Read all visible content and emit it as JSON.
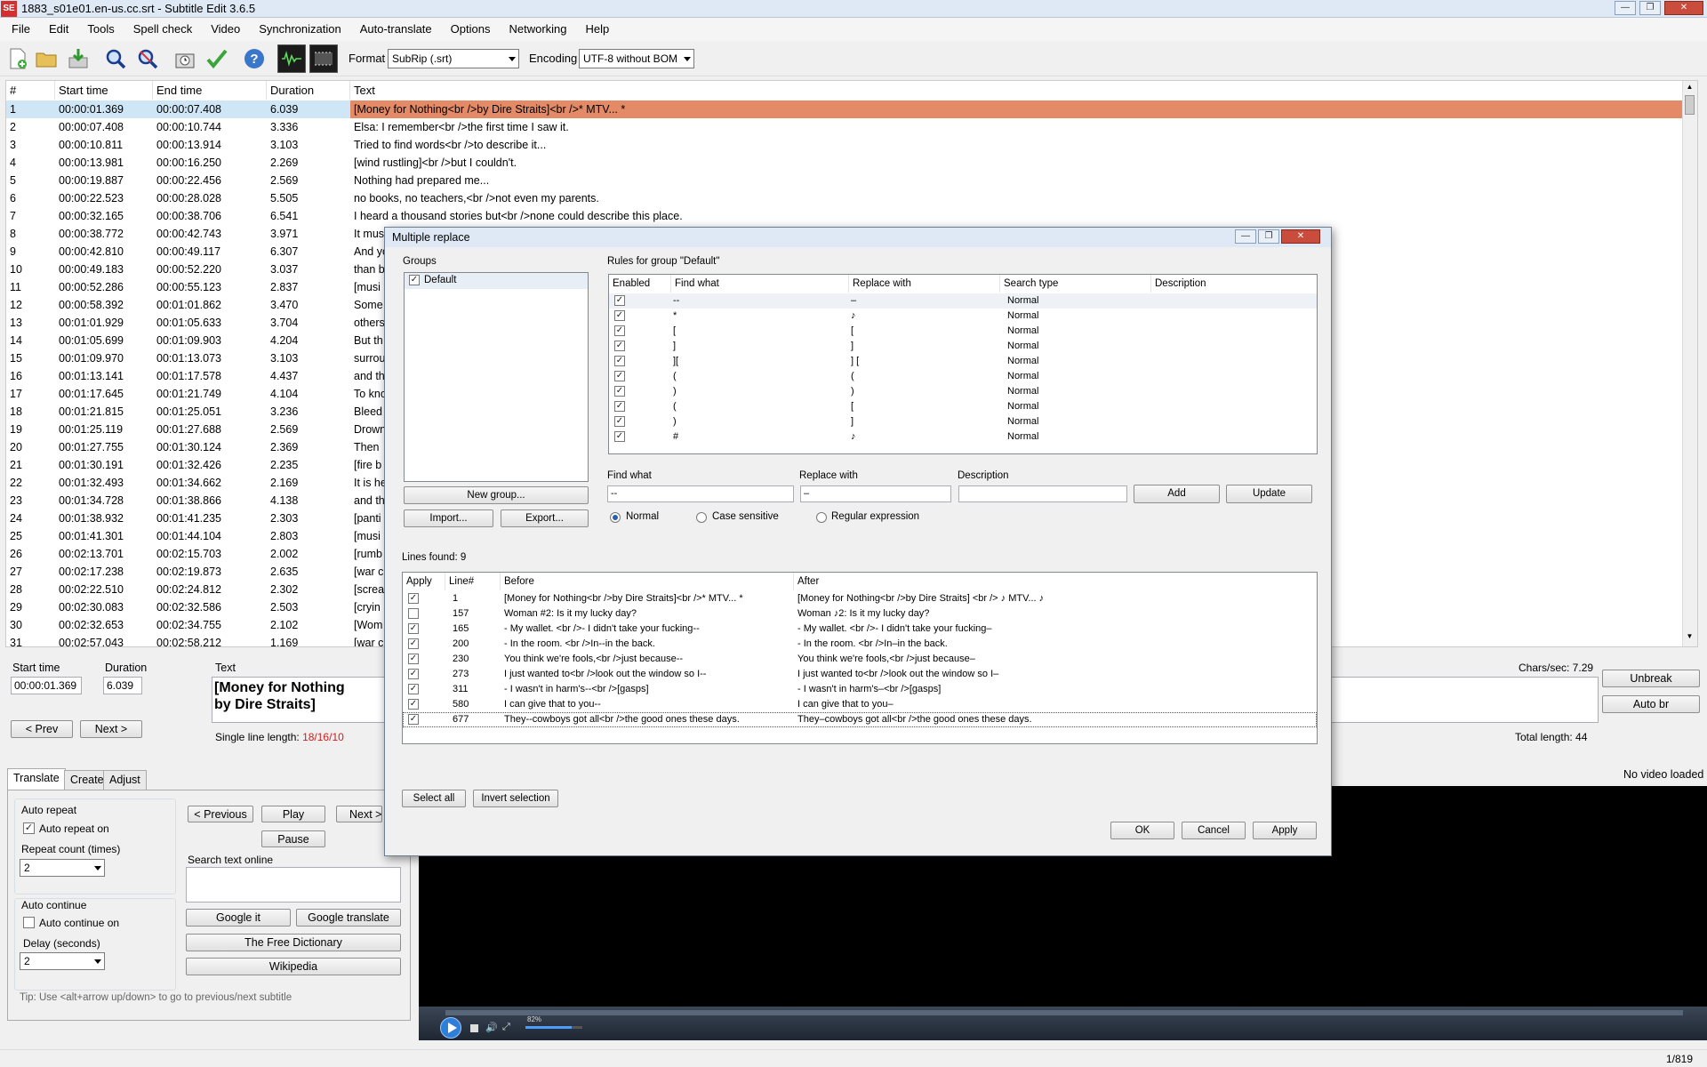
{
  "window": {
    "title": "1883_s01e01.en-us.cc.srt - Subtitle Edit 3.6.5",
    "icon_text": "SE"
  },
  "menu": [
    "File",
    "Edit",
    "Tools",
    "Spell check",
    "Video",
    "Synchronization",
    "Auto-translate",
    "Options",
    "Networking",
    "Help"
  ],
  "toolbar": {
    "icons": [
      "new-file-icon",
      "open-folder-icon",
      "save-icon",
      "find-icon",
      "replace-icon",
      "visual-sync-icon",
      "spell-check-icon",
      "help-icon",
      "waveform-icon",
      "video-icon"
    ],
    "format_label": "Format",
    "format_value": "SubRip (.srt)",
    "encoding_label": "Encoding",
    "encoding_value": "UTF-8 without BOM"
  },
  "grid": {
    "headers": [
      "#",
      "Start time",
      "End time",
      "Duration",
      "Text"
    ],
    "rows": [
      [
        "1",
        "00:00:01.369",
        "00:00:07.408",
        "6.039",
        "[Money for Nothing<br />by Dire Straits]<br />* MTV... *"
      ],
      [
        "2",
        "00:00:07.408",
        "00:00:10.744",
        "3.336",
        "Elsa: I remember<br />the first time I saw it."
      ],
      [
        "3",
        "00:00:10.811",
        "00:00:13.914",
        "3.103",
        "Tried to find words<br />to describe it..."
      ],
      [
        "4",
        "00:00:13.981",
        "00:00:16.250",
        "2.269",
        "[wind rustling]<br />but I couldn't."
      ],
      [
        "5",
        "00:00:19.887",
        "00:00:22.456",
        "2.569",
        "Nothing had prepared me..."
      ],
      [
        "6",
        "00:00:22.523",
        "00:00:28.028",
        "5.505",
        "no books, no teachers,<br />not even my parents."
      ],
      [
        "7",
        "00:00:32.165",
        "00:00:38.706",
        "6.541",
        "I heard a thousand stories but<br />none could describe this place."
      ],
      [
        "8",
        "00:00:38.772",
        "00:00:42.743",
        "3.971",
        "It mus"
      ],
      [
        "9",
        "00:00:42.810",
        "00:00:49.117",
        "6.307",
        "And yo"
      ],
      [
        "10",
        "00:00:49.183",
        "00:00:52.220",
        "3.037",
        "than b"
      ],
      [
        "11",
        "00:00:52.286",
        "00:00:55.123",
        "2.837",
        "[musi"
      ],
      [
        "12",
        "00:00:58.392",
        "00:01:01.862",
        "3.470",
        "Some"
      ],
      [
        "13",
        "00:01:01.929",
        "00:01:05.633",
        "3.704",
        "others"
      ],
      [
        "14",
        "00:01:05.699",
        "00:01:09.903",
        "4.204",
        "But th"
      ],
      [
        "15",
        "00:01:09.970",
        "00:01:13.073",
        "3.103",
        "surrou"
      ],
      [
        "16",
        "00:01:13.141",
        "00:01:17.578",
        "4.437",
        "and th"
      ],
      [
        "17",
        "00:01:17.645",
        "00:01:21.749",
        "4.104",
        "To kno"
      ],
      [
        "18",
        "00:01:21.815",
        "00:01:25.051",
        "3.236",
        "Bleed"
      ],
      [
        "19",
        "00:01:25.119",
        "00:01:27.688",
        "2.569",
        "Drown"
      ],
      [
        "20",
        "00:01:27.755",
        "00:01:30.124",
        "2.369",
        "Then"
      ],
      [
        "21",
        "00:01:30.191",
        "00:01:32.426",
        "2.235",
        "[fire b"
      ],
      [
        "22",
        "00:01:32.493",
        "00:01:34.662",
        "2.169",
        "It is he"
      ],
      [
        "23",
        "00:01:34.728",
        "00:01:38.866",
        "4.138",
        "and th"
      ],
      [
        "24",
        "00:01:38.932",
        "00:01:41.235",
        "2.303",
        "[panti"
      ],
      [
        "25",
        "00:01:41.301",
        "00:01:44.104",
        "2.803",
        "[musi"
      ],
      [
        "26",
        "00:02:13.701",
        "00:02:15.703",
        "2.002",
        "[rumb"
      ],
      [
        "27",
        "00:02:17.238",
        "00:02:19.873",
        "2.635",
        "[war c"
      ],
      [
        "28",
        "00:02:22.510",
        "00:02:24.812",
        "2.302",
        "[screa"
      ],
      [
        "29",
        "00:02:30.083",
        "00:02:32.586",
        "2.503",
        "[cryin"
      ],
      [
        "30",
        "00:02:32.653",
        "00:02:34.755",
        "2.102",
        "[Wom"
      ],
      [
        "31",
        "00:02:57.043",
        "00:02:58.212",
        "1.169",
        "[war c"
      ]
    ]
  },
  "editor": {
    "start_label": "Start time",
    "start_value": "00:00:01.369",
    "duration_label": "Duration",
    "duration_value": "6.039",
    "text_label": "Text",
    "text_line1": "[Money for Nothing",
    "text_line2": "by Dire Straits]",
    "prev": "< Prev",
    "next": "Next >",
    "single_line_label": "Single line length: ",
    "single_line_value": "18/16/10",
    "chars_sec": "Chars/sec: 7.29",
    "total_length": "Total length: 44",
    "unbreak": "Unbreak",
    "auto_br": "Auto br"
  },
  "bottom": {
    "tabs": [
      "Translate",
      "Create",
      "Adjust"
    ],
    "auto_repeat_title": "Auto repeat",
    "auto_repeat_on": "Auto repeat on",
    "repeat_count_label": "Repeat count (times)",
    "repeat_count_value": "2",
    "auto_continue_title": "Auto continue",
    "auto_continue_on": "Auto continue on",
    "delay_label": "Delay (seconds)",
    "delay_value": "2",
    "previous": "< Previous",
    "play": "Play",
    "next": "Next >",
    "pause": "Pause",
    "search_online_label": "Search text online",
    "google_it": "Google it",
    "google_translate": "Google translate",
    "free_dictionary": "The Free Dictionary",
    "wikipedia": "Wikipedia",
    "tip": "Tip: Use <alt+arrow up/down> to go to previous/next subtitle",
    "no_video": "No video loaded",
    "volume": "82%"
  },
  "status": {
    "position": "1/819"
  },
  "dialog": {
    "title": "Multiple replace",
    "groups_label": "Groups",
    "group_name": "Default",
    "new_group": "New group...",
    "import": "Import...",
    "export": "Export...",
    "rules_label": "Rules for group \"Default\"",
    "rules_headers": [
      "Enabled",
      "Find what",
      "Replace with",
      "Search type",
      "Description"
    ],
    "rules": [
      [
        "--",
        "–",
        "Normal"
      ],
      [
        "*",
        "♪",
        "Normal"
      ],
      [
        "[",
        "[",
        "Normal"
      ],
      [
        "]",
        "]",
        "Normal"
      ],
      [
        "][",
        "] [",
        "Normal"
      ],
      [
        "(",
        "(",
        "Normal"
      ],
      [
        ")",
        ")",
        "Normal"
      ],
      [
        "(",
        "[",
        "Normal"
      ],
      [
        ")",
        "]",
        "Normal"
      ],
      [
        "#",
        "♪",
        "Normal"
      ]
    ],
    "find_label": "Find what",
    "find_value": "--",
    "replace_label": "Replace with",
    "replace_value": "–",
    "desc_label": "Description",
    "desc_value": "",
    "add": "Add",
    "update": "Update",
    "opt_normal": "Normal",
    "opt_case": "Case sensitive",
    "opt_regex": "Regular expression",
    "lines_found": "Lines found: 9",
    "res_headers": [
      "Apply",
      "Line#",
      "Before",
      "After"
    ],
    "results": [
      [
        true,
        "1",
        "[Money for Nothing<br />by Dire Straits]<br />* MTV... *",
        "[Money for Nothing<br />by Dire Straits] <br /> ♪ MTV... ♪"
      ],
      [
        false,
        "157",
        "Woman #2: Is it my lucky day?",
        "Woman ♪2: Is it my lucky day?"
      ],
      [
        true,
        "165",
        "- My wallet. <br />- I didn't take your fucking--",
        "- My wallet. <br />- I didn't take your fucking–"
      ],
      [
        true,
        "200",
        "- In the room. <br />In--in the back.",
        "- In the room. <br />In–in the back."
      ],
      [
        true,
        "230",
        "You think we're fools,<br />just because--",
        "You think we're fools,<br />just because–"
      ],
      [
        true,
        "273",
        "I just wanted to<br />look out the window so I--",
        "I just wanted to<br />look out the window so I–"
      ],
      [
        true,
        "311",
        "- I wasn't in harm's--<br />[gasps]",
        "- I wasn't in harm's–<br />[gasps]"
      ],
      [
        true,
        "580",
        "I can give that to you--",
        "I can give that to you–"
      ],
      [
        true,
        "677",
        "They--cowboys got all<br />the good ones these days.",
        "They–cowboys got all<br />the good ones these days."
      ]
    ],
    "select_all": "Select all",
    "invert_selection": "Invert selection",
    "ok": "OK",
    "cancel": "Cancel",
    "apply": "Apply"
  }
}
